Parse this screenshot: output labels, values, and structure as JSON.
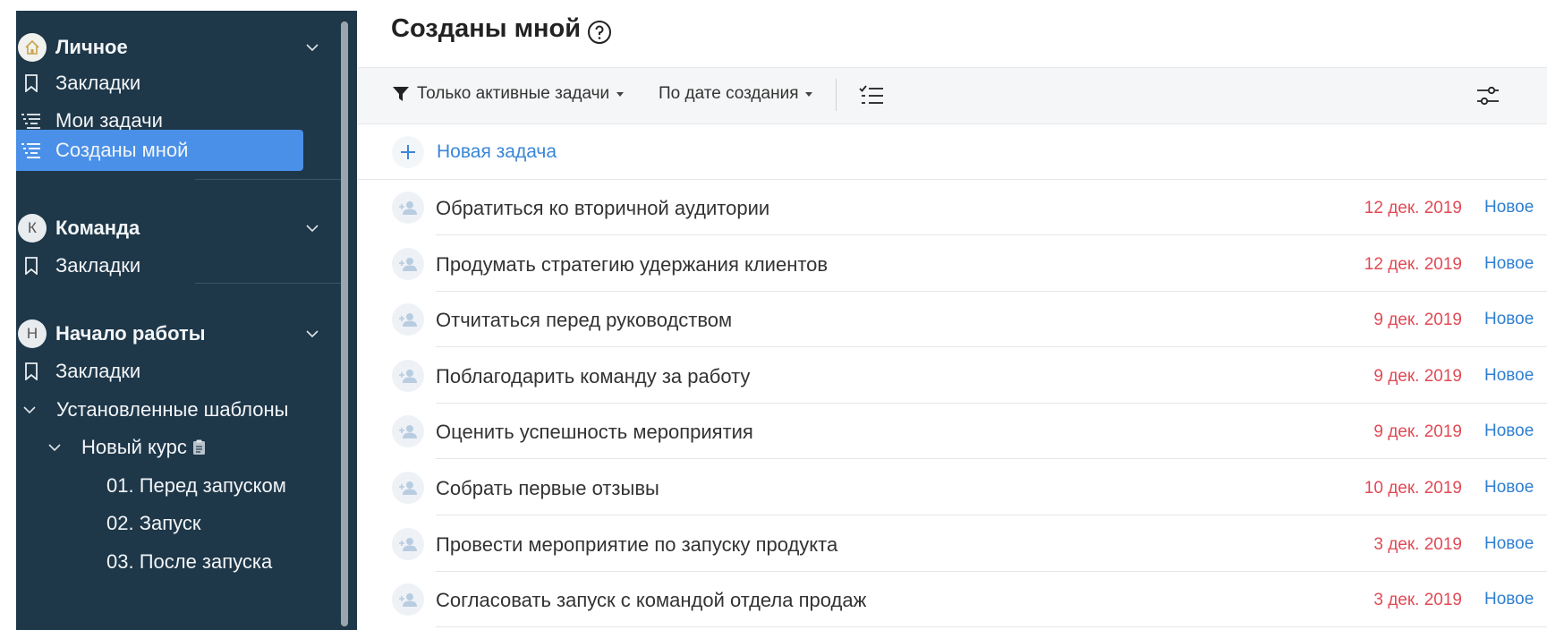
{
  "sidebar": {
    "personal": {
      "title": "Личное",
      "bookmarks": "Закладки",
      "my_tasks": "Мои задачи",
      "created_by_me": "Созданы мной"
    },
    "team": {
      "avatar": "К",
      "title": "Команда",
      "bookmarks": "Закладки"
    },
    "getting_started": {
      "avatar": "Н",
      "title": "Начало работы",
      "bookmarks": "Закладки",
      "installed_templates": "Установленные шаблоны",
      "new_course": "Новый курс",
      "items": [
        "01. Перед запуском",
        "02. Запуск",
        "03. После запуска"
      ]
    }
  },
  "main": {
    "title": "Созданы мной",
    "toolbar": {
      "filter_label": "Только активные задачи",
      "sort_label": "По дате создания"
    },
    "new_task_label": "Новая задача",
    "tasks": [
      {
        "title": "Обратиться ко вторичной аудитории",
        "date": "12 дек. 2019",
        "status": "Новое"
      },
      {
        "title": "Продумать стратегию удержания клиентов",
        "date": "12 дек. 2019",
        "status": "Новое"
      },
      {
        "title": "Отчитаться перед руководством",
        "date": "9 дек. 2019",
        "status": "Новое"
      },
      {
        "title": "Поблагодарить команду за работу",
        "date": "9 дек. 2019",
        "status": "Новое"
      },
      {
        "title": "Оценить успешность мероприятия",
        "date": "9 дек. 2019",
        "status": "Новое"
      },
      {
        "title": "Собрать первые отзывы",
        "date": "10 дек. 2019",
        "status": "Новое"
      },
      {
        "title": "Провести мероприятие по запуску продукта",
        "date": "3 дек. 2019",
        "status": "Новое"
      },
      {
        "title": "Согласовать запуск с командой отдела продаж",
        "date": "3 дек. 2019",
        "status": "Новое"
      }
    ]
  },
  "colors": {
    "sidebar_bg": "#1e3749",
    "active_item": "#4a90e8",
    "date_red": "#e04a55",
    "status_blue": "#2f7fd2",
    "link_blue": "#3a86d8"
  }
}
